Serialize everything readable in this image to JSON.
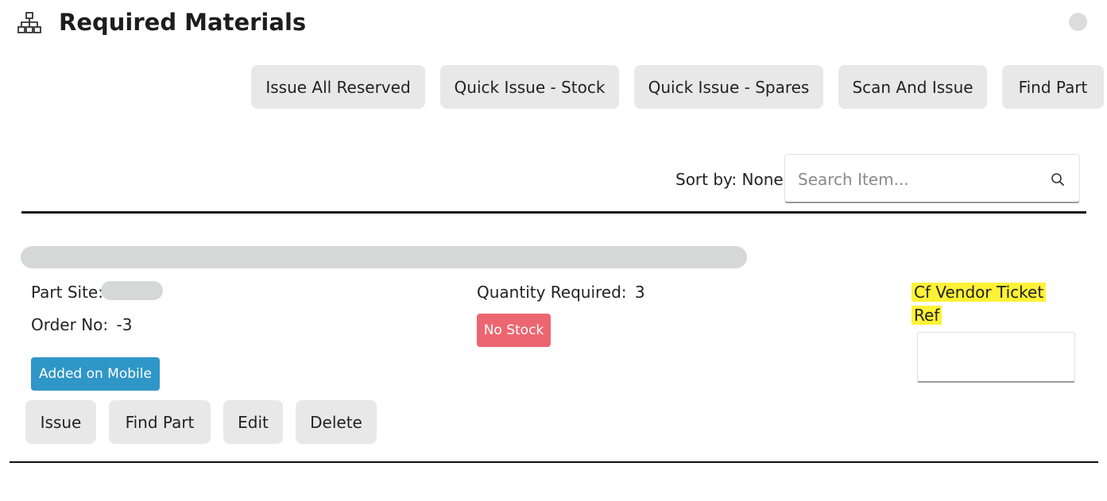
{
  "header": {
    "title": "Required Materials",
    "icon": "sitemap-icon"
  },
  "toolbar": {
    "buttons": [
      {
        "label": "Issue All Reserved"
      },
      {
        "label": "Quick Issue - Stock"
      },
      {
        "label": "Quick Issue - Spares"
      },
      {
        "label": "Scan And Issue"
      },
      {
        "label": "Find Part"
      }
    ]
  },
  "sort": {
    "label": "Sort by: None"
  },
  "search": {
    "placeholder": "Search Item...",
    "value": "",
    "icon": "search-icon"
  },
  "item": {
    "part_site_label": "Part Site:",
    "order_label": "Order No:",
    "order_value": "-3",
    "quantity_label": "Quantity Required:",
    "quantity_value": "3",
    "source_badge": "Added on Mobile",
    "stock_badge": "No Stock",
    "custom_field_label_line1": "Cf Vendor Ticket",
    "custom_field_label_line2": "Ref",
    "custom_field_value": "",
    "actions": [
      {
        "label": "Issue"
      },
      {
        "label": "Find Part"
      },
      {
        "label": "Edit"
      },
      {
        "label": "Delete"
      }
    ]
  },
  "colors": {
    "button_bg": "#e8e8e8",
    "badge_mobile": "#2f96c8",
    "badge_nostock": "#ec6671",
    "highlight": "#fff236"
  }
}
